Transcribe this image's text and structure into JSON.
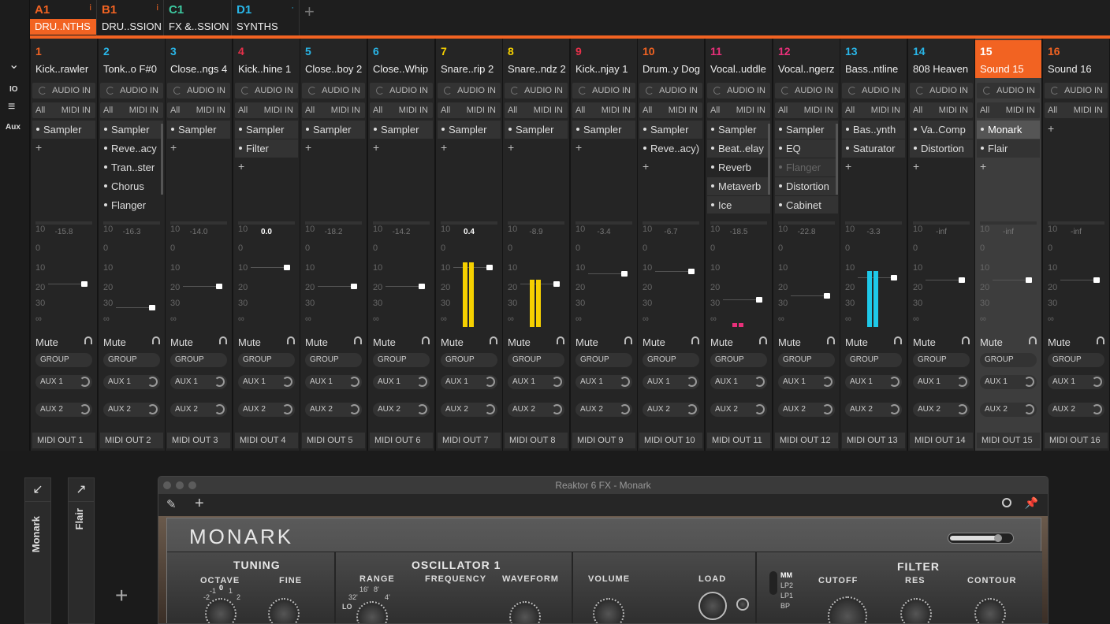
{
  "left_panel": {
    "chevron": "⌄",
    "io": "IO",
    "menu": "≡",
    "aux": "Aux"
  },
  "groups": [
    {
      "letter": "A1",
      "name": "DRU..NTHS",
      "color": "#f26322",
      "info": "i",
      "selected": true
    },
    {
      "letter": "B1",
      "name": "DRU..SSION",
      "color": "#f26322",
      "info": "i",
      "selected": false
    },
    {
      "letter": "C1",
      "name": "FX &..SSION",
      "color": "#3dc9a0",
      "info": "",
      "selected": false
    },
    {
      "letter": "D1",
      "name": "SYNTHS",
      "color": "#29b6e8",
      "info": "·",
      "selected": false
    }
  ],
  "add_group": "+",
  "channels": [
    {
      "num": "1",
      "name": "Kick..rawler",
      "color": "#f26322",
      "audio": "AUDIO IN",
      "all": "All",
      "midi": "MIDI IN",
      "plugins": [
        {
          "n": "Sampler",
          "on": true
        }
      ],
      "peak": "-15.8",
      "fader": -2,
      "mo": "MIDI OUT  1"
    },
    {
      "num": "2",
      "name": "Tonk..o F#0",
      "color": "#29b6e8",
      "audio": "AUDIO IN",
      "all": "All",
      "midi": "MIDI IN",
      "plugins": [
        {
          "n": "Sampler",
          "on": true
        },
        {
          "n": "Reve..acy",
          "on": false
        },
        {
          "n": "Tran..ster",
          "on": false
        },
        {
          "n": "Chorus",
          "on": false
        },
        {
          "n": "Flanger",
          "on": false
        }
      ],
      "peak": "-16.3",
      "fader": -15,
      "mo": "MIDI OUT  2",
      "scroll": true
    },
    {
      "num": "3",
      "name": "Close..ngs 4",
      "color": "#29b6e8",
      "audio": "AUDIO IN",
      "all": "All",
      "midi": "MIDI IN",
      "plugins": [
        {
          "n": "Sampler",
          "on": true
        }
      ],
      "peak": "-14.0",
      "fader": -3,
      "mo": "MIDI OUT  3"
    },
    {
      "num": "4",
      "name": "Kick..hine 1",
      "color": "#e8304a",
      "audio": "AUDIO IN",
      "all": "All",
      "midi": "MIDI IN",
      "plugins": [
        {
          "n": "Sampler",
          "on": true
        },
        {
          "n": "Filter",
          "on": true
        }
      ],
      "peak": "0.0",
      "peakw": true,
      "fader": 6,
      "mo": "MIDI OUT  4"
    },
    {
      "num": "5",
      "name": "Close..boy 2",
      "color": "#29b6e8",
      "audio": "AUDIO IN",
      "all": "All",
      "midi": "MIDI IN",
      "plugins": [
        {
          "n": "Sampler",
          "on": true
        }
      ],
      "peak": "-18.2",
      "fader": -3,
      "mo": "MIDI OUT  5"
    },
    {
      "num": "6",
      "name": "Close..Whip",
      "color": "#29b6e8",
      "audio": "AUDIO IN",
      "all": "All",
      "midi": "MIDI IN",
      "plugins": [
        {
          "n": "Sampler",
          "on": true
        }
      ],
      "peak": "-14.2",
      "fader": -3,
      "mo": "MIDI OUT  6"
    },
    {
      "num": "7",
      "name": "Snare..rip 2",
      "color": "#f5d000",
      "audio": "AUDIO IN",
      "all": "All",
      "midi": "MIDI IN",
      "plugins": [
        {
          "n": "Sampler",
          "on": true
        }
      ],
      "peak": "0.4",
      "peakw": true,
      "fader": 6,
      "mo": "MIDI OUT  7",
      "meter": {
        "color": "#f5d000",
        "level": 0.98
      }
    },
    {
      "num": "8",
      "name": "Snare..ndz 2",
      "color": "#f5d000",
      "audio": "AUDIO IN",
      "all": "All",
      "midi": "MIDI IN",
      "plugins": [
        {
          "n": "Sampler",
          "on": true
        }
      ],
      "peak": "-8.9",
      "fader": -2,
      "mo": "MIDI OUT  8",
      "meter": {
        "color": "#f5d000",
        "level": 0.72
      }
    },
    {
      "num": "9",
      "name": "Kick..njay 1",
      "color": "#e8304a",
      "audio": "AUDIO IN",
      "all": "All",
      "midi": "MIDI IN",
      "plugins": [
        {
          "n": "Sampler",
          "on": true
        }
      ],
      "peak": "-3.4",
      "fader": 3,
      "mo": "MIDI OUT  9"
    },
    {
      "num": "10",
      "name": "Drum..y Dog",
      "color": "#f26322",
      "audio": "AUDIO IN",
      "all": "All",
      "midi": "MIDI IN",
      "plugins": [
        {
          "n": "Sampler",
          "on": true
        },
        {
          "n": "Reve..acy)",
          "on": false
        }
      ],
      "peak": "-6.7",
      "fader": 4,
      "mo": "MIDI OUT  10"
    },
    {
      "num": "11",
      "name": "Vocal..uddle",
      "color": "#e8307a",
      "audio": "AUDIO IN",
      "all": "All",
      "midi": "MIDI IN",
      "plugins": [
        {
          "n": "Sampler",
          "on": true
        },
        {
          "n": "Beat..elay",
          "on": true
        },
        {
          "n": "Reverb",
          "on": false
        },
        {
          "n": "Metaverb",
          "on": true
        },
        {
          "n": "Ice",
          "on": true
        }
      ],
      "peak": "-18.5",
      "fader": -10,
      "mo": "MIDI OUT  11",
      "meter": {
        "color": "#e8307a",
        "level": 0.06
      },
      "scroll": true
    },
    {
      "num": "12",
      "name": "Vocal..ngerz",
      "color": "#e8307a",
      "audio": "AUDIO IN",
      "all": "All",
      "midi": "MIDI IN",
      "plugins": [
        {
          "n": "Sampler",
          "on": true
        },
        {
          "n": "EQ",
          "on": true
        },
        {
          "n": "Flanger",
          "on": true,
          "dim": true
        },
        {
          "n": "Distortion",
          "on": true
        },
        {
          "n": "Cabinet",
          "on": true
        }
      ],
      "peak": "-22.8",
      "fader": -8,
      "mo": "MIDI OUT  12",
      "scroll": true
    },
    {
      "num": "13",
      "name": "Bass..ntline",
      "color": "#29b6e8",
      "audio": "AUDIO IN",
      "all": "All",
      "midi": "MIDI IN",
      "plugins": [
        {
          "n": "Bas..ynth",
          "on": true
        },
        {
          "n": "Saturator",
          "on": true
        }
      ],
      "peak": "-3.3",
      "fader": 1,
      "mo": "MIDI OUT  13",
      "meter": {
        "color": "#1ec8e8",
        "level": 0.85
      }
    },
    {
      "num": "14",
      "name": "808 Heaven",
      "color": "#29b6e8",
      "audio": "AUDIO IN",
      "all": "All",
      "midi": "MIDI IN",
      "plugins": [
        {
          "n": "Va..Comp",
          "on": true
        },
        {
          "n": "Distortion",
          "on": true
        }
      ],
      "peak": "-inf",
      "fader": 0,
      "mo": "MIDI OUT  14"
    },
    {
      "num": "15",
      "name": "Sound 15",
      "color": "#ffffff",
      "audio": "AUDIO IN",
      "all": "All",
      "midi": "MIDI IN",
      "plugins": [
        {
          "n": "Monark",
          "on": true,
          "sel": true
        },
        {
          "n": "Flair",
          "on": true
        }
      ],
      "peak": "-inf",
      "fader": 0,
      "mo": "MIDI OUT  15",
      "selected": true
    },
    {
      "num": "16",
      "name": "Sound 16",
      "color": "#f26322",
      "audio": "AUDIO IN",
      "all": "All",
      "midi": "MIDI IN",
      "plugins": [],
      "peak": "-inf",
      "fader": 0,
      "mo": "MIDI OUT  16"
    }
  ],
  "strip": {
    "mute": "Mute",
    "group": "GROUP",
    "aux1": "AUX 1",
    "aux2": "AUX 2",
    "plus": "+",
    "scale": [
      "10",
      "0",
      "10",
      "20",
      "30",
      "∞"
    ]
  },
  "bottom": {
    "side1": {
      "icon": "↙",
      "label": "Monark"
    },
    "side2": {
      "icon": "↗",
      "label": "Flair"
    },
    "plus": "+",
    "window_title": "Reaktor 6 FX - Monark",
    "logo": "MONARK",
    "sections": {
      "tuning": "TUNING",
      "octave": "OCTAVE",
      "fine": "FINE",
      "osc": "OSCILLATOR 1",
      "range": "RANGE",
      "frequency": "FREQUENCY",
      "waveform": "WAVEFORM",
      "volume": "VOLUME",
      "load": "LOAD",
      "filter": "FILTER",
      "cutoff": "CUTOFF",
      "res": "RES",
      "contour": "CONTOUR",
      "modes": [
        "MM",
        "LP2",
        "LP1",
        "BP"
      ],
      "oct_vals": [
        "-1",
        "0",
        "1"
      ],
      "oct_vals2": [
        "-2",
        "2"
      ],
      "range_vals": [
        "32'",
        "16'",
        "8'",
        "4'"
      ],
      "lo": "LO"
    }
  }
}
